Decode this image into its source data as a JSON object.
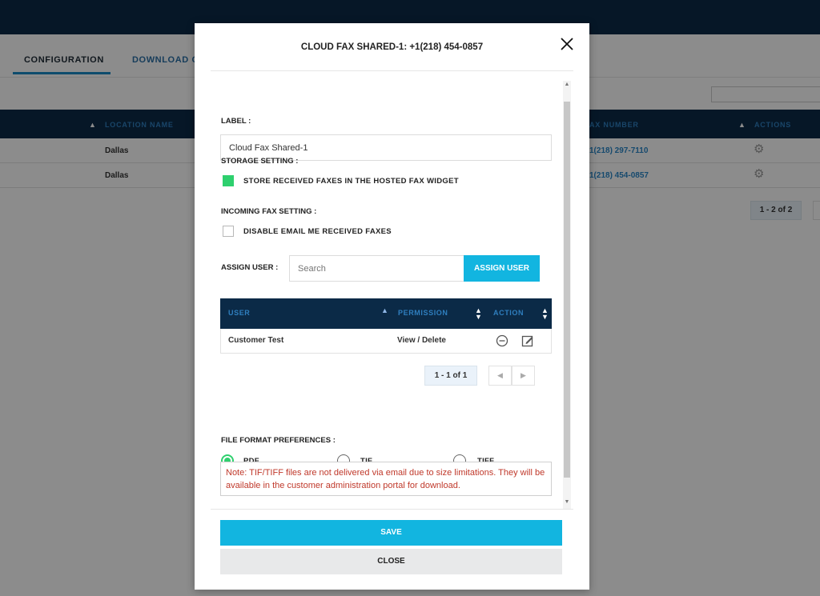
{
  "background": {
    "tabs": [
      "CONFIGURATION",
      "DOWNLOAD C"
    ],
    "table_headers": {
      "location": "LOCATION NAME",
      "fax": "AX NUMBER",
      "actions": "ACTIONS"
    },
    "rows": [
      {
        "location": "Dallas",
        "fax": "1(218) 297-7110"
      },
      {
        "location": "Dallas",
        "fax": "1(218) 454-0857"
      }
    ],
    "pager": "1 - 2 of 2"
  },
  "modal": {
    "title": "CLOUD FAX SHARED-1: +1(218) 454-0857",
    "label_heading": "LABEL :",
    "label_value": "Cloud Fax Shared-1",
    "storage_heading": "STORAGE SETTING :",
    "storage_option": "STORE RECEIVED FAXES IN THE HOSTED FAX WIDGET",
    "storage_checked": true,
    "incoming_heading": "INCOMING FAX SETTING :",
    "incoming_option": "DISABLE EMAIL ME RECEIVED FAXES",
    "incoming_checked": false,
    "assign_heading": "ASSIGN USER :",
    "assign_placeholder": "Search",
    "assign_button": "ASSIGN USER",
    "user_table": {
      "headers": {
        "user": "USER",
        "permission": "PERMISSION",
        "action": "ACTION"
      },
      "rows": [
        {
          "user": "Customer Test",
          "permission": "View / Delete"
        }
      ],
      "pager": "1 - 1 of 1"
    },
    "format_heading": "FILE FORMAT PREFERENCES :",
    "formats": [
      {
        "label": "PDF",
        "selected": true
      },
      {
        "label": "TIF",
        "selected": false
      },
      {
        "label": "TIFF",
        "selected": false
      }
    ],
    "note": "Note: TIF/TIFF files are not delivered via email due to size limitations. They will be available in the customer administration portal for download.",
    "save_button": "SAVE",
    "close_button": "CLOSE"
  },
  "colors": {
    "navy": "#0b2a47",
    "accent_blue": "#12b5e0",
    "green": "#2ed06e",
    "note_red": "#c0392b"
  }
}
